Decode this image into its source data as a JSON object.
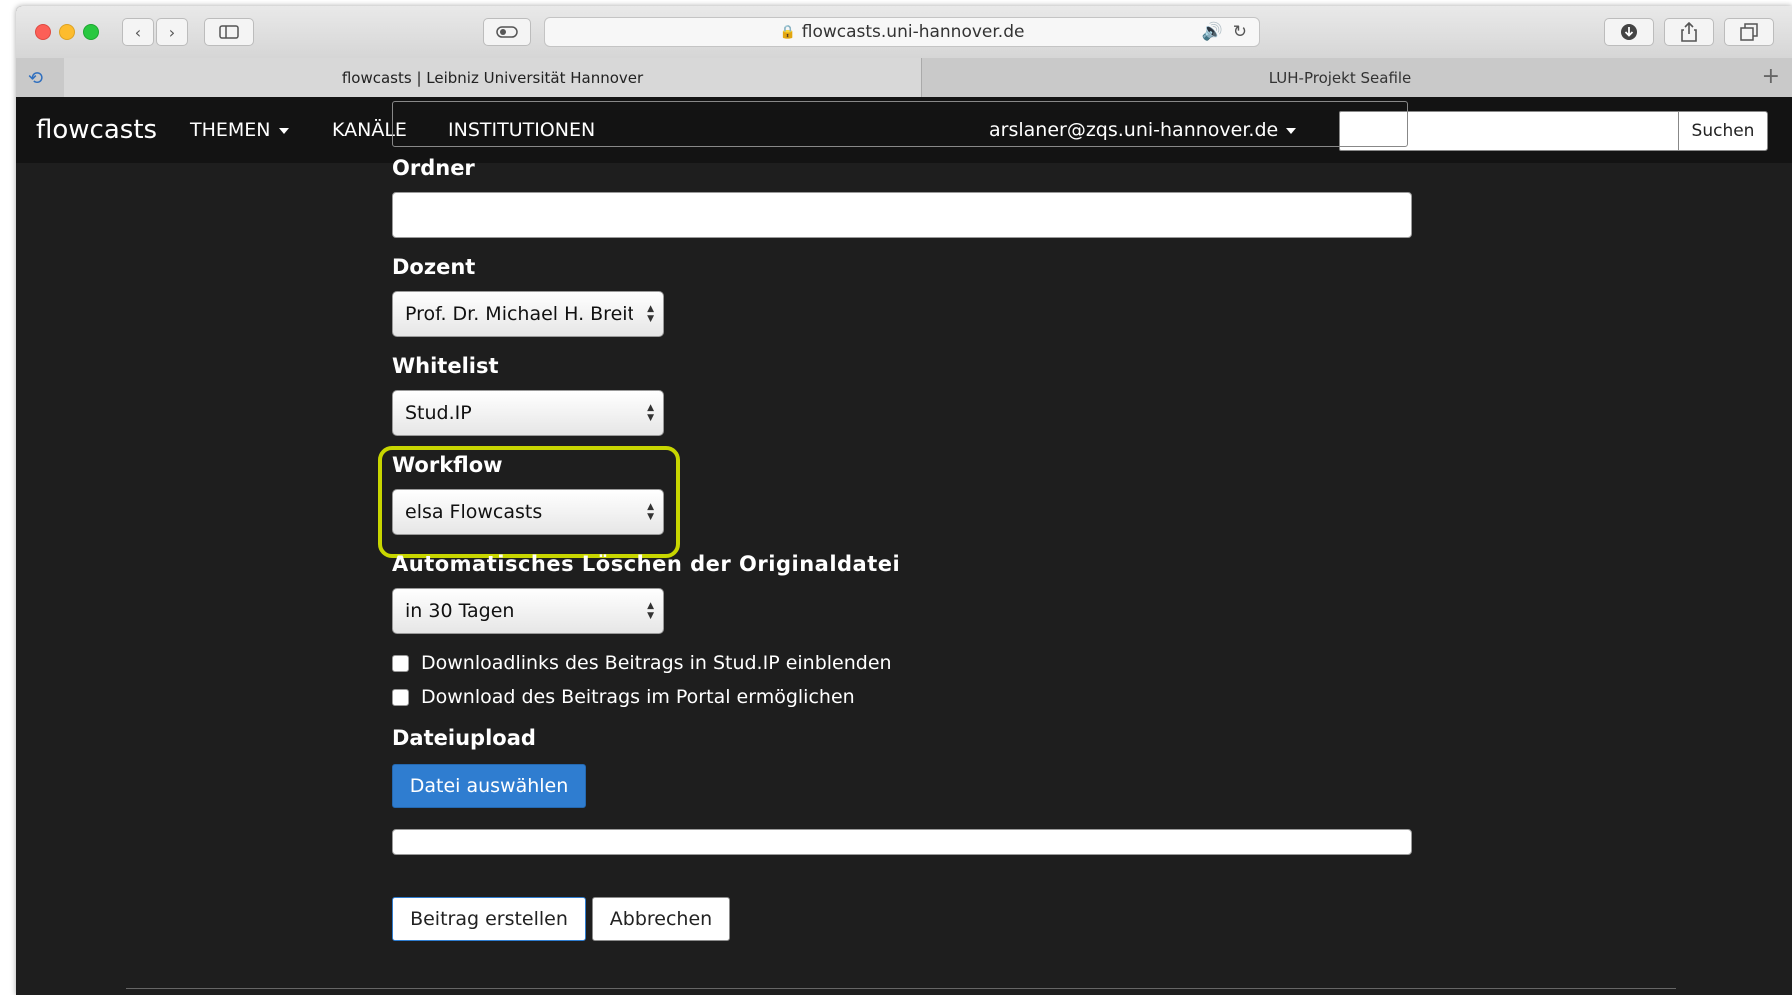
{
  "browser": {
    "url": "flowcasts.uni-hannover.de",
    "tabs": [
      {
        "label": "flowcasts | Leibniz Universität Hannover",
        "active": true
      },
      {
        "label": "LUH-Projekt Seafile",
        "active": false
      }
    ]
  },
  "navbar": {
    "brand": "flowcasts",
    "links": [
      "THEMEN",
      "KANÄLE",
      "INSTITUTIONEN"
    ],
    "user": "arslaner@zqs.uni-hannover.de",
    "search_button": "Suchen",
    "search_placeholder": ""
  },
  "form": {
    "ordner_label": "Ordner",
    "ordner_value": "",
    "dozent_label": "Dozent",
    "dozent_value": "Prof. Dr. Michael H. Breitner",
    "whitelist_label": "Whitelist",
    "whitelist_value": "Stud.IP",
    "workflow_label": "Workflow",
    "workflow_value": "elsa Flowcasts",
    "autodelete_label": "Automatisches Löschen der Originaldatei",
    "autodelete_value": "in 30 Tagen",
    "checkbox_downloadlinks": "Downloadlinks des Beitrags in Stud.IP einblenden",
    "checkbox_download_portal": "Download des Beitrags im Portal ermöglichen",
    "upload_label": "Dateiupload",
    "upload_button": "Datei auswählen",
    "submit_button": "Beitrag erstellen",
    "cancel_button": "Abbrechen"
  },
  "colors": {
    "page_background": "#1e1e1e",
    "navbar_background": "#131313",
    "primary_button": "#2f7dd0",
    "highlight": "#c8d600"
  }
}
